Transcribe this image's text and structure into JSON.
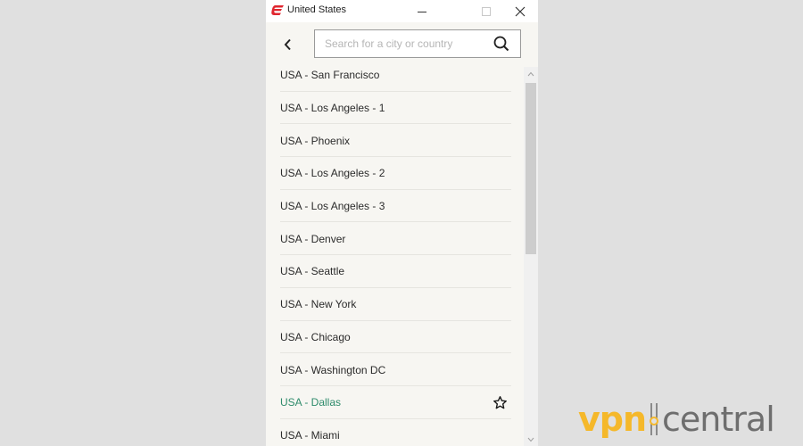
{
  "window": {
    "title": "United States",
    "controls": {
      "minimize": "minimize",
      "maximize": "maximize",
      "close": "close"
    }
  },
  "search": {
    "placeholder": "Search for a city or country",
    "value": ""
  },
  "locations": [
    {
      "label": "USA - San Francisco",
      "active": false
    },
    {
      "label": "USA - Los Angeles - 1",
      "active": false
    },
    {
      "label": "USA - Phoenix",
      "active": false
    },
    {
      "label": "USA - Los Angeles - 2",
      "active": false
    },
    {
      "label": "USA - Los Angeles - 3",
      "active": false
    },
    {
      "label": "USA - Denver",
      "active": false
    },
    {
      "label": "USA - Seattle",
      "active": false
    },
    {
      "label": "USA - New York",
      "active": false
    },
    {
      "label": "USA - Chicago",
      "active": false
    },
    {
      "label": "USA - Washington DC",
      "active": false
    },
    {
      "label": "USA - Dallas",
      "active": true,
      "favorite_icon": "star-outline-icon"
    },
    {
      "label": "USA - Miami",
      "active": false
    }
  ],
  "colors": {
    "brand_red": "#e0262f",
    "active_text": "#2e8b6b",
    "list_background": "#f7f6f2"
  },
  "watermark": {
    "part1": "vpn",
    "part2": "central"
  }
}
